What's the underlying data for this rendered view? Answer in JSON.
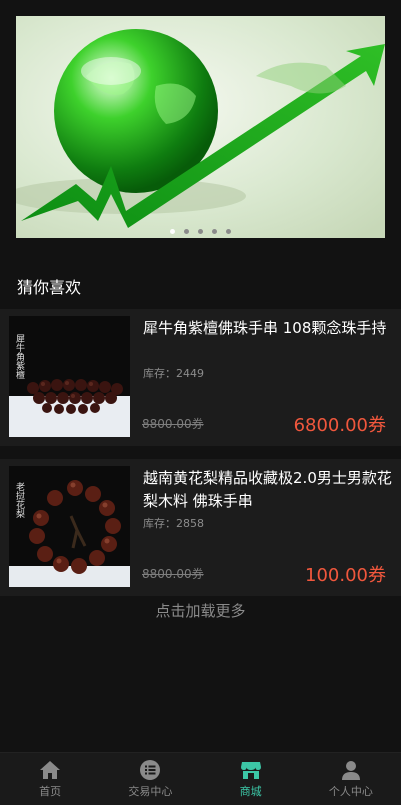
{
  "banner": {
    "slides": 5,
    "active": 0
  },
  "section": {
    "title": "猜你喜欢"
  },
  "products": [
    {
      "name": "犀牛角紫檀佛珠手串 108颗念珠手持",
      "stock": "库存：2449",
      "old_price": "8800.00券",
      "price": "6800.00券",
      "image_text": "犀牛角紫檀"
    },
    {
      "name": "越南黄花梨精品收藏极2.0男士男款花梨木料 佛珠手串",
      "stock": "库存：2858",
      "old_price": "8800.00券",
      "price": "100.00券",
      "image_text": "老挝花梨"
    }
  ],
  "load_more": "点击加载更多",
  "tabs": [
    {
      "label": "首页",
      "icon": "home-icon"
    },
    {
      "label": "交易中心",
      "icon": "list-icon"
    },
    {
      "label": "商城",
      "icon": "shop-icon"
    },
    {
      "label": "个人中心",
      "icon": "user-icon"
    }
  ],
  "active_tab": 2,
  "colors": {
    "accent": "#3cc6a6",
    "price": "#f0573d",
    "background": "#121212",
    "card": "#1c1c1c"
  }
}
